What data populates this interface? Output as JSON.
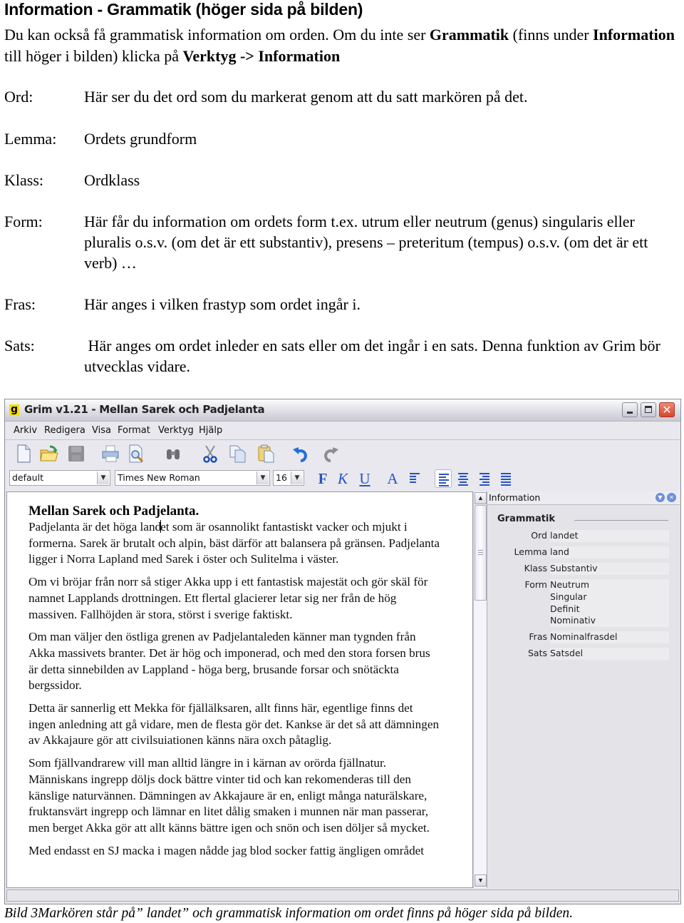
{
  "document": {
    "title": "Information - Grammatik (höger sida på bilden)",
    "intro": {
      "part1": "Du kan också få grammatisk information om orden. Om du inte ser ",
      "bold1": "Grammatik",
      "part2": " (finns under ",
      "bold2": "Information",
      "part3": " till höger i bilden) klicka på ",
      "bold3": "Verktyg -> Information"
    },
    "definitions": [
      {
        "label": "Ord:",
        "text": "Här ser du det ord som du markerat genom att du satt markören på det."
      },
      {
        "label": "Lemma:",
        "text": "Ordets grundform"
      },
      {
        "label": "Klass:",
        "text": "Ordklass"
      },
      {
        "label": "Form:",
        "text": "Här får du information om ordets form t.ex. utrum eller neutrum (genus) singularis eller pluralis o.s.v. (om det är ett substantiv), presens – preteritum (tempus) o.s.v. (om det är ett verb) …"
      },
      {
        "label": "Fras:",
        "text": "Här anges i vilken frastyp som ordet ingår i."
      },
      {
        "label": "Sats:",
        "text": " Här anges om ordet inleder en sats eller om det ingår i en sats. Denna funktion av Grim bör utvecklas vidare."
      }
    ],
    "caption": "Bild 3Markören står på” landet” och grammatisk information om ordet  finns på höger sida på bilden."
  },
  "window": {
    "app_icon": "g",
    "title": "Grim v1.21 - Mellan Sarek och Padjelanta",
    "menu": [
      "Arkiv",
      "Redigera",
      "Visa",
      "Format",
      "Verktyg",
      "Hjälp"
    ],
    "toolbar_icons": [
      "new-document-icon",
      "open-folder-icon",
      "save-icon",
      "print-icon",
      "print-preview-icon",
      "find-binoculars-icon",
      "cut-scissors-icon",
      "copy-icon",
      "paste-icon",
      "undo-icon",
      "redo-icon"
    ],
    "format": {
      "style_value": "default",
      "font_value": "Times New Roman",
      "size_value": "16",
      "bold_label": "F",
      "italic_label": "K",
      "underline_label": "U",
      "color_label": "A"
    },
    "editor": {
      "heading": "Mellan Sarek och Padjelanta.",
      "p1_before_caret": "Padjelanta är det höga land",
      "p1_after_caret": "et som är osannolikt fantastiskt vacker och mjukt i formerna. Sarek är brutalt och alpin, bäst därför att balansera på gränsen. Padjelanta ligger i Norra Lapland med Sarek i öster och Sulitelma i väster.",
      "paragraphs": [
        "Om vi bröjar från norr så stiger Akka upp i ett fantastisk majestät och gör skäl för namnet Lapplands drottningen. Ett flertal glacierer letar sig ner från de hög massiven. Fallhöjden är stora, störst i sverige faktiskt.",
        "Om man väljer den östliga grenen av Padjelantaleden känner man tygnden från Akka massivets branter. Det är hög och imponerad, och med den stora forsen brus är detta sinnebilden av Lappland - höga berg, brusande forsar och snötäckta bergssidor.",
        "Detta är sannerlig ett Mekka för fjällälksaren, allt finns här, egentlige finns det ingen anledning att gå vidare, men de flesta gör det. Kankse är det så att dämningen av Akkajaure gör att civilsuiationen känns nära oxch påtaglig.",
        "Som fjällvandrarew vill man alltid längre in i kärnan av orörda fjällnatur. Människans ingrepp döljs dock bättre vinter tid och kan rekomenderas till den känslige naturvännen. Dämningen av Akkajaure är en, enligt många naturälskare, fruktansvärt ingrepp och lämnar en litet dålig smaken i munnen när man passerar, men berget Akka gör att allt känns bättre igen och snön och isen döljer så mycket.",
        "Med endasst en SJ macka i magen nådde jag blod socker fattig ängligen området"
      ]
    },
    "info_panel": {
      "header": "Information",
      "section_title": "Grammatik",
      "rows": [
        {
          "key": "Ord",
          "values": [
            "landet"
          ]
        },
        {
          "key": "Lemma",
          "values": [
            "land"
          ]
        },
        {
          "key": "Klass",
          "values": [
            "Substantiv"
          ]
        },
        {
          "key": "Form",
          "values": [
            "Neutrum",
            "Singular",
            "Definit",
            "Nominativ"
          ]
        },
        {
          "key": "Fras",
          "values": [
            "Nominalfrasdel"
          ]
        },
        {
          "key": "Sats",
          "values": [
            "Satsdel"
          ]
        }
      ]
    }
  }
}
